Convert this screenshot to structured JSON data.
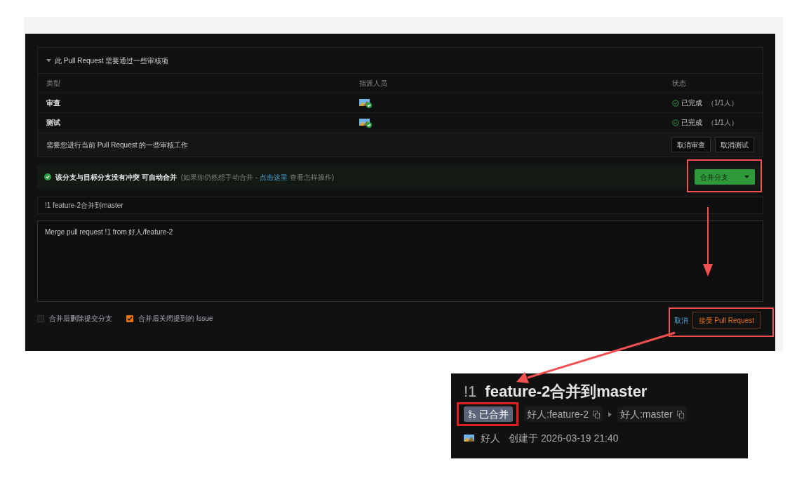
{
  "review_panel": {
    "title": "此 Pull Request 需要通过一些审核项",
    "expanded": true,
    "columns": [
      "类型",
      "指派人员",
      "状态"
    ],
    "rows": [
      {
        "type": "审查",
        "status": "已完成",
        "count": "（1/1人）"
      },
      {
        "type": "测试",
        "status": "已完成",
        "count": "（1/1人）"
      }
    ],
    "footer_text": "需要您进行当前 Pull Request 的一些审核工作",
    "buttons": [
      "取消审查",
      "取消测试"
    ]
  },
  "merge_status": {
    "text": "该分支与目标分支没有冲突 可自动合并",
    "hint_before": "(如果你仍然想手动合并 -",
    "link": "点击这里",
    "hint_after": "查看怎样操作)",
    "button": "合并分支"
  },
  "title_field": {
    "value": "!1 feature-2合并到master"
  },
  "message_field": {
    "value": "Merge pull request !1 from 好人/feature-2"
  },
  "options": [
    {
      "label": "合并后删除提交分支",
      "checked": false
    },
    {
      "label": "合并后关闭提到的 Issue",
      "checked": true
    }
  ],
  "actions": {
    "cancel": "取消",
    "accept": "接受 Pull Request"
  },
  "result": {
    "number": "!1",
    "title": "feature-2合并到master",
    "state": "已合并",
    "source": "好人:feature-2",
    "target": "好人:master",
    "author": "好人",
    "created": "创建于 2026-03-19 21:40"
  }
}
